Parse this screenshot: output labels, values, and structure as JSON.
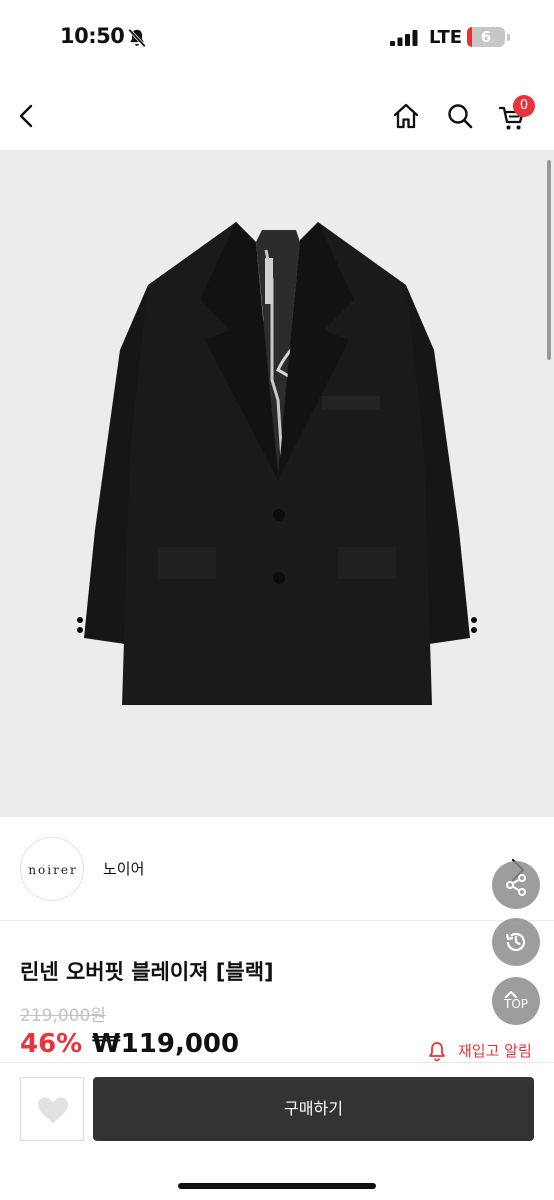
{
  "status_bar": {
    "time": "10:50",
    "network": "LTE",
    "battery": "6"
  },
  "nav": {
    "cart_count": "0"
  },
  "seller": {
    "logo_text": "noirer",
    "name": "노이어"
  },
  "fab": {
    "top_label": "TOP"
  },
  "product": {
    "title": "린넨 오버핏 블레이져 [블랙]",
    "original_price": "219,000원",
    "discount": "46%",
    "sale_price": "₩119,000",
    "restock_label": "재입고 알림"
  },
  "bottom_bar": {
    "buy_label": "구매하기"
  },
  "colors": {
    "accent_red": "#e8333a",
    "buy_button": "#333333",
    "image_bg": "#ececec"
  },
  "icons": [
    "bell-off-icon",
    "signal-icon",
    "battery-icon",
    "back-icon",
    "home-icon",
    "search-icon",
    "cart-icon",
    "chevron-right-icon",
    "share-icon",
    "history-icon",
    "arrow-up-icon",
    "bell-icon",
    "heart-icon"
  ]
}
